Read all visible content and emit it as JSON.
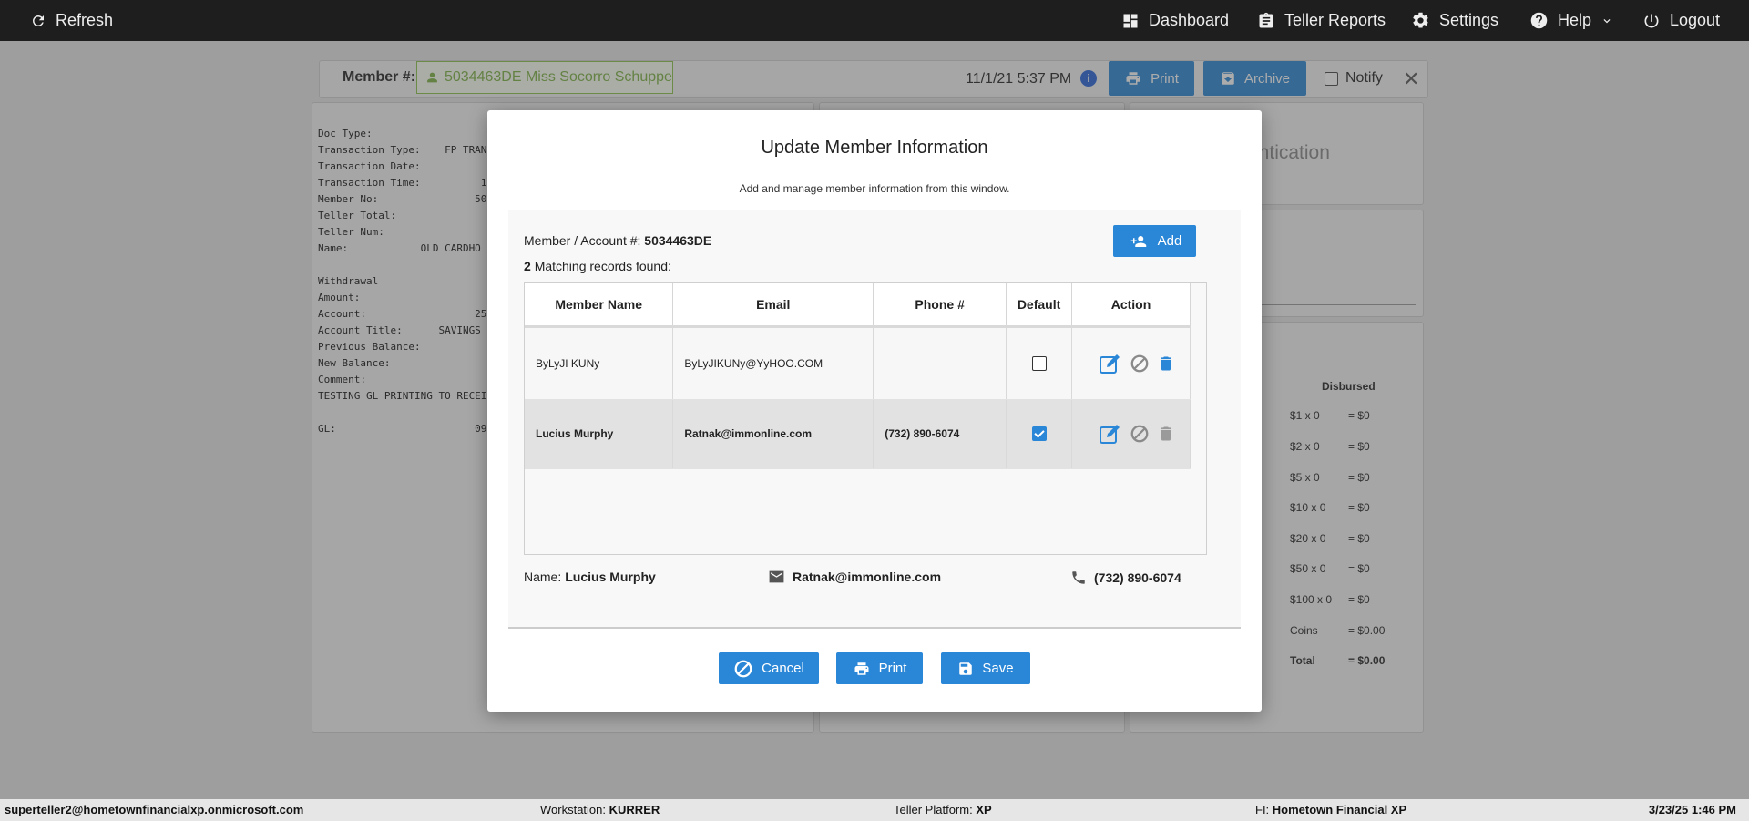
{
  "topbar": {
    "refresh": "Refresh",
    "dashboard": "Dashboard",
    "teller_reports": "Teller Reports",
    "settings": "Settings",
    "help": "Help",
    "logout": "Logout"
  },
  "member_bar": {
    "label": "Member #:",
    "member": "5034463DE Miss Socorro Schuppe",
    "datetime": "11/1/21 5:37 PM",
    "print": "Print",
    "archive": "Archive",
    "notify": "Notify"
  },
  "receipt": {
    "text": "Doc Type:\nTransaction Type:    FP TRAN\nTransaction Date:\nTransaction Time:          1\nMember No:                50\nTeller Total:\nTeller Num:\nName:            OLD CARDHO\n\nWithdrawal\nAmount:\nAccount:                  25\nAccount Title:      SAVINGS\nPrevious Balance:\nNew Balance:\nComment:\nTESTING GL PRINTING TO RECEI\n\nGL:                       09"
  },
  "right_panel": {
    "auth_text": "entication",
    "disbursed_header": "Disbursed",
    "denominations": [
      {
        "label": "$1 x 0",
        "value": "= $0"
      },
      {
        "label": "$2 x 0",
        "value": "= $0"
      },
      {
        "label": "$5 x 0",
        "value": "= $0"
      },
      {
        "label": "$10 x 0",
        "value": "= $0"
      },
      {
        "label": "$20 x 0",
        "value": "= $0"
      },
      {
        "label": "$50 x 0",
        "value": "= $0"
      },
      {
        "label": "$100 x 0",
        "value": "= $0"
      },
      {
        "label": "Coins",
        "value": "= $0.00"
      },
      {
        "label": "Total",
        "value": "= $0.00"
      }
    ]
  },
  "modal": {
    "title": "Update Member Information",
    "subtitle": "Add and manage member information from this window.",
    "account_label": "Member / Account #:",
    "account_number": "5034463DE",
    "match_count": "2",
    "match_text": "Matching records found:",
    "add_label": "Add",
    "columns": [
      "Member Name",
      "Email",
      "Phone #",
      "Default",
      "Action"
    ],
    "rows": [
      {
        "name": "ByLyJI KUNy",
        "email": "ByLyJIKUNy@YyHOO.COM",
        "phone": "",
        "default": false
      },
      {
        "name": "Lucius Murphy",
        "email": "Ratnak@immonline.com",
        "phone": "(732) 890-6074",
        "default": true
      }
    ],
    "detail": {
      "name_label": "Name:",
      "name": "Lucius Murphy",
      "email": "Ratnak@immonline.com",
      "phone": "(732) 890-6074"
    },
    "cancel_label": "Cancel",
    "print_label": "Print",
    "save_label": "Save"
  },
  "statusbar": {
    "user": "superteller2@hometownfinancialxp.onmicrosoft.com",
    "workstation_label": "Workstation:",
    "workstation": "KURRER",
    "platform_label": "Teller Platform:",
    "platform": "XP",
    "fi_label": "FI:",
    "fi": "Hometown Financial XP",
    "datetime": "3/23/25 1:46 PM"
  },
  "colors": {
    "accent": "#2a86d6",
    "member_chip": "#7cb342",
    "topbar": "#1e1e1e"
  }
}
